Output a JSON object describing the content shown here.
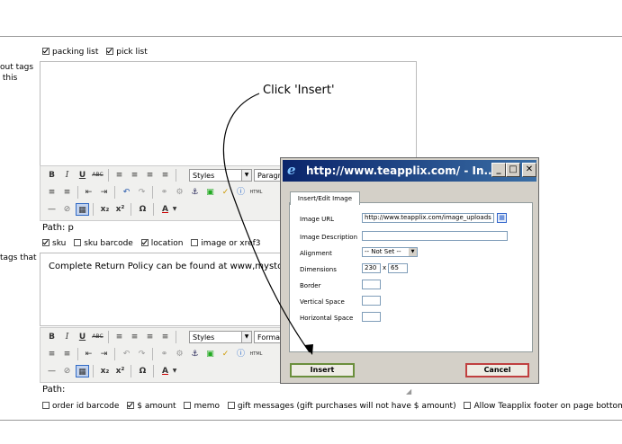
{
  "page": {
    "side_label_1": "out tags\n this",
    "side_label_2": "tags that",
    "top_checks": [
      {
        "label": "packing list",
        "checked": true
      },
      {
        "label": "pick list",
        "checked": true
      }
    ],
    "mid_checks": [
      {
        "label": "sku",
        "checked": true
      },
      {
        "label": "sku barcode",
        "checked": false
      },
      {
        "label": "location",
        "checked": true
      },
      {
        "label": "image or xref3",
        "checked": false
      }
    ],
    "bottom_checks": [
      {
        "label": "order id barcode",
        "checked": false
      },
      {
        "label": "$ amount",
        "checked": true
      },
      {
        "label": "memo",
        "checked": false
      },
      {
        "label": "gift messages (gift purchases will not have $ amount)",
        "checked": false
      },
      {
        "label": "Allow Teapplix footer on page bottom",
        "checked": false
      }
    ]
  },
  "editor1": {
    "styles": "Styles",
    "format": "Paragra",
    "path": "Path: p"
  },
  "editor2": {
    "content": "Complete Return Policy can be found at www,mystore",
    "styles": "Styles",
    "format": "Format",
    "path": "Path:"
  },
  "annotation": "Click 'Insert'",
  "dialog": {
    "title": "http://www.teapplix.com/ - In...",
    "tab": "Insert/Edit Image",
    "labels": {
      "url": "Image URL",
      "description": "Image Description",
      "alignment": "Alignment",
      "dimensions": "Dimensions",
      "border": "Border",
      "vspace": "Vertical Space",
      "hspace": "Horizontal Space"
    },
    "url_value": "http://www.teapplix.com/image_uploads",
    "alignment_value": "-- Not Set --",
    "width": "230",
    "dim_sep": "x",
    "height": "65",
    "insert": "Insert",
    "cancel": "Cancel"
  }
}
